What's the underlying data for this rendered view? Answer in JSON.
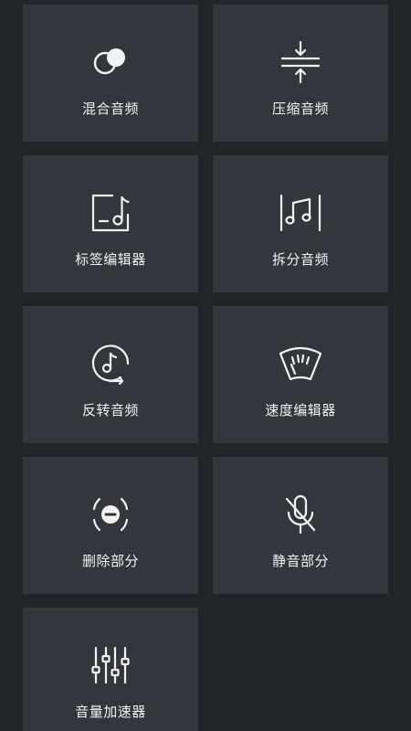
{
  "tools": [
    {
      "label": "混合音频",
      "icon": "mix-audio-icon"
    },
    {
      "label": "压缩音频",
      "icon": "compress-audio-icon"
    },
    {
      "label": "标签编辑器",
      "icon": "tag-editor-icon"
    },
    {
      "label": "拆分音频",
      "icon": "split-audio-icon"
    },
    {
      "label": "反转音频",
      "icon": "reverse-audio-icon"
    },
    {
      "label": "速度编辑器",
      "icon": "speed-editor-icon"
    },
    {
      "label": "删除部分",
      "icon": "delete-part-icon"
    },
    {
      "label": "静音部分",
      "icon": "mute-part-icon"
    },
    {
      "label": "音量加速器",
      "icon": "volume-booster-icon"
    }
  ],
  "colors": {
    "background": "#232428",
    "tile": "#35363b",
    "foreground": "#f2f2f2"
  }
}
